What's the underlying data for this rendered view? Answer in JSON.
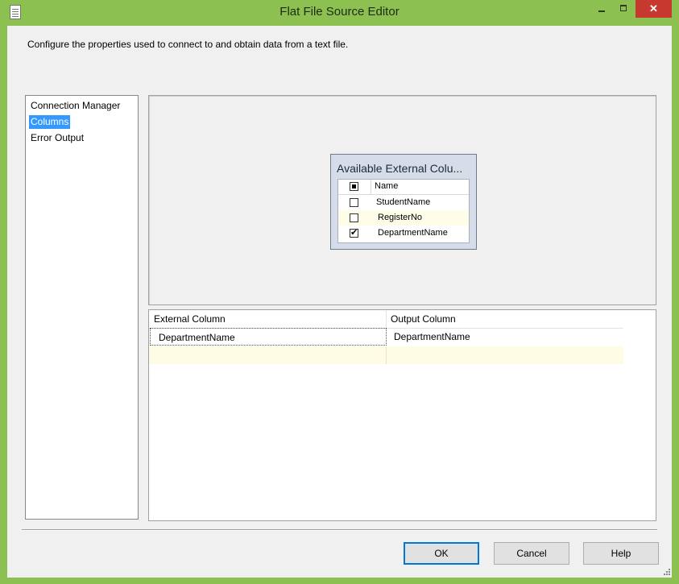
{
  "window": {
    "title": "Flat File Source Editor",
    "icon": "document-icon",
    "accent_color": "#8cc152",
    "close_color": "#c7392f"
  },
  "description": "Configure the properties used to connect to and obtain data from a text file.",
  "nav": {
    "items": [
      {
        "label": "Connection Manager",
        "selected": false
      },
      {
        "label": "Columns",
        "selected": true
      },
      {
        "label": "Error Output",
        "selected": false
      }
    ],
    "selected_color": "#3399ff"
  },
  "external_columns": {
    "title": "Available External Colu...",
    "header": "Name",
    "rows": [
      {
        "name": "StudentName",
        "checked": false
      },
      {
        "name": "RegisterNo",
        "checked": false
      },
      {
        "name": "DepartmentName",
        "checked": true
      }
    ]
  },
  "mapping": {
    "headers": [
      "External Column",
      "Output Column"
    ],
    "rows": [
      {
        "external": "DepartmentName",
        "output": "DepartmentName"
      }
    ]
  },
  "buttons": {
    "ok": "OK",
    "cancel": "Cancel",
    "help": "Help"
  },
  "window_controls": {
    "minimize": "minimize-icon",
    "maximize": "maximize-icon",
    "close": "✕"
  }
}
